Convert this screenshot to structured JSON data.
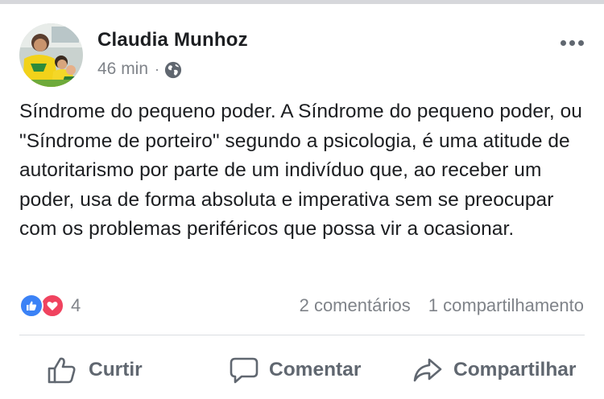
{
  "post": {
    "author": "Claudia Munhoz",
    "time": "46 min",
    "separator": "·",
    "audience_icon": "globe-icon",
    "text": "Síndrome do pequeno poder. A Síndrome do pequeno poder, ou \"Síndrome de porteiro\" segundo a psicologia, é uma atitude de autoritarismo por parte de um indivíduo que, ao receber um poder, usa de forma absoluta e imperativa sem se preocupar com os problemas periféricos que possa vir a ocasionar."
  },
  "reactions": {
    "icons": [
      "like-icon",
      "love-icon"
    ],
    "count": "4"
  },
  "stats": {
    "comments": "2 comentários",
    "shares": "1 compartilhamento"
  },
  "actions": {
    "like": "Curtir",
    "comment": "Comentar",
    "share": "Compartilhar"
  },
  "colors": {
    "text": "#1c1e21",
    "secondary": "#7f8389",
    "like_blue": "#3b82f6",
    "love_red": "#f0435f",
    "divider": "#dadde1"
  }
}
